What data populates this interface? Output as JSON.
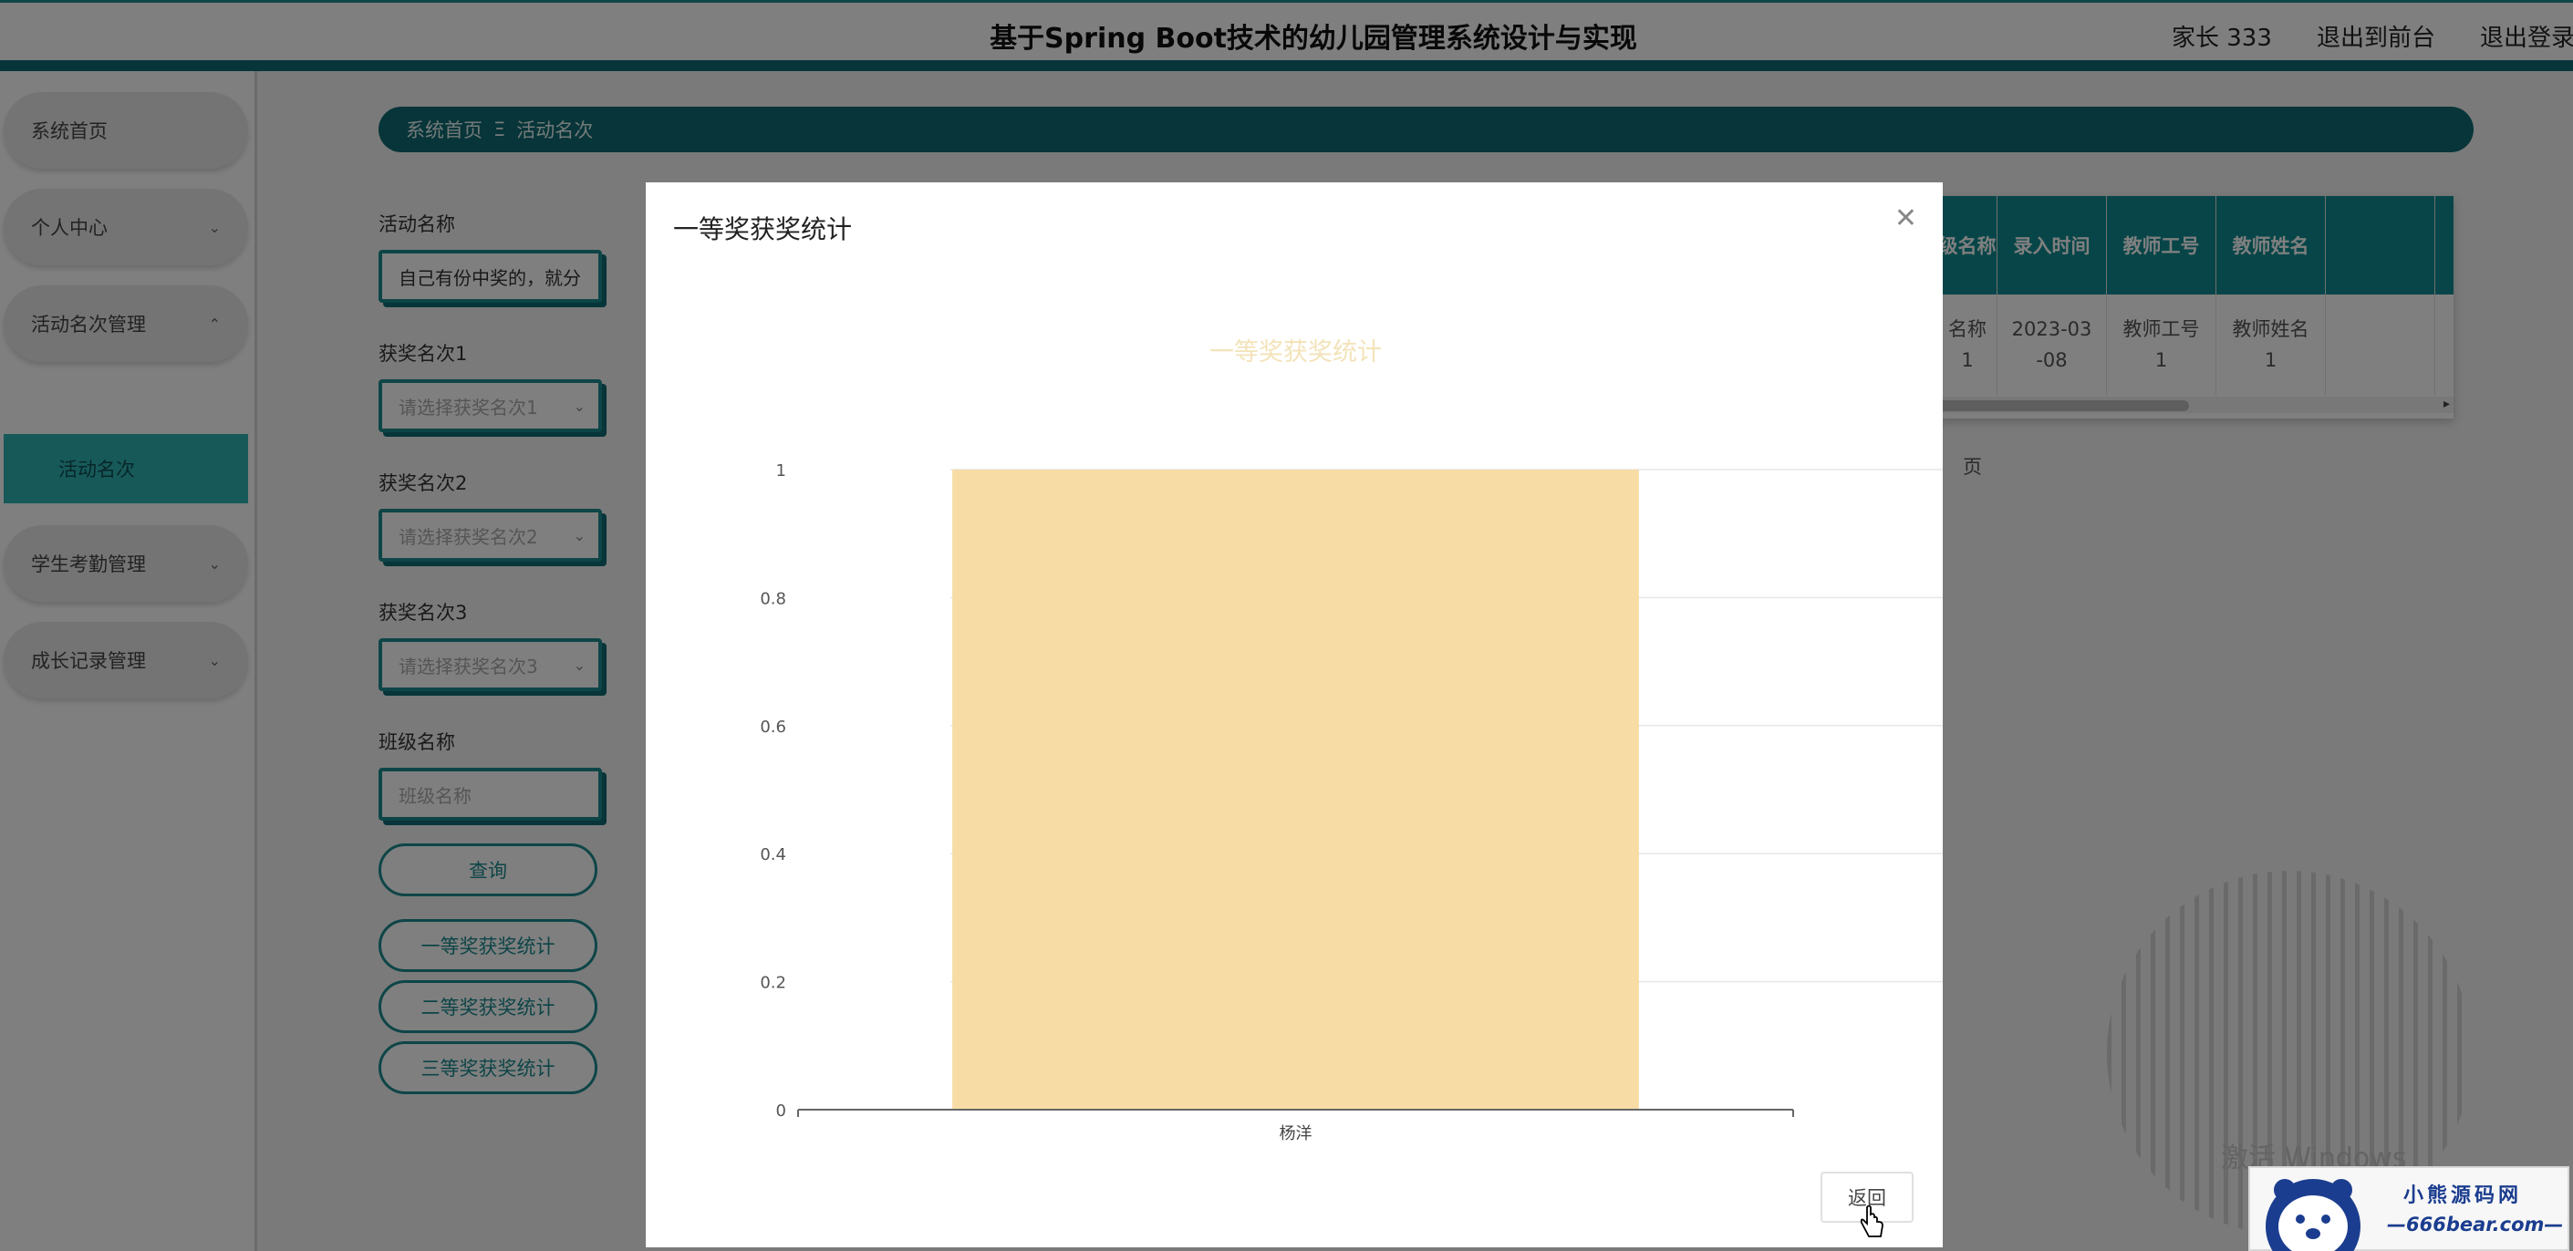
{
  "header": {
    "title": "基于Spring Boot技术的幼儿园管理系统设计与实现",
    "user_label": "家长 333",
    "frontend_link": "退出到前台",
    "logout_link": "退出登录"
  },
  "sidebar": {
    "items": [
      {
        "label": "系统首页"
      },
      {
        "label": "个人中心"
      },
      {
        "label": "活动名次管理"
      },
      {
        "label": "活动名次"
      },
      {
        "label": "学生考勤管理"
      },
      {
        "label": "成长记录管理"
      }
    ]
  },
  "breadcrumb": {
    "home": "系统首页",
    "separator": "Ξ",
    "current": "活动名次"
  },
  "filters": {
    "activity_name_label": "活动名称",
    "activity_name_value": "自己有份中奖的，就分",
    "award1_label": "获奖名次1",
    "award1_placeholder": "请选择获奖名次1",
    "award2_label": "获奖名次2",
    "award2_placeholder": "请选择获奖名次2",
    "award3_label": "获奖名次3",
    "award3_placeholder": "请选择获奖名次3",
    "class_label": "班级名称",
    "class_placeholder": "班级名称",
    "query_button": "查询",
    "stat1_button": "一等奖获奖统计",
    "stat2_button": "二等奖获奖统计",
    "stat3_button": "三等奖获奖统计"
  },
  "table": {
    "headers": [
      "级名称",
      "录入时间",
      "教师工号",
      "教师姓名"
    ],
    "row": [
      "名称\n1",
      "2023-03\n-08",
      "教师工号\n1",
      "教师姓名\n1"
    ],
    "page_suffix": "页"
  },
  "watermark": "激活 Windows",
  "modal": {
    "title": "一等奖获奖统计",
    "return_button": "返回"
  },
  "chart_data": {
    "type": "bar",
    "title": "一等奖获奖统计",
    "categories": [
      "杨洋"
    ],
    "values": [
      1
    ],
    "ylim": [
      0,
      1
    ],
    "yticks": [
      "0",
      "0.2",
      "0.4",
      "0.6",
      "0.8",
      "1"
    ],
    "bar_color": "#f7dca6",
    "title_color": "#f3e3b9",
    "grid": true
  },
  "logo": {
    "line1": "小熊源码网",
    "line2": "—666bear.com—"
  },
  "colors": {
    "accent": "#1c8a8e",
    "dark_teal": "#0f6a72"
  }
}
